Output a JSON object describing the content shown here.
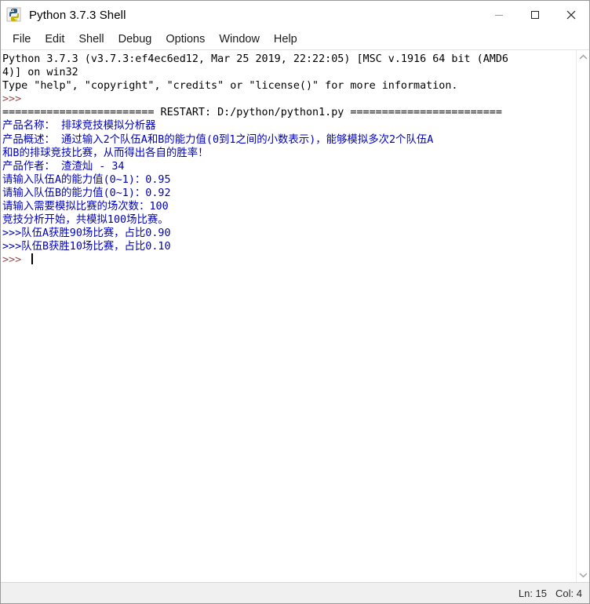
{
  "window": {
    "title": "Python 3.7.3 Shell",
    "icon": "python-idle-icon",
    "controls": {
      "minimize": "minimize-icon",
      "maximize": "maximize-icon",
      "close": "close-icon"
    }
  },
  "menubar": {
    "items": [
      {
        "label": "File"
      },
      {
        "label": "Edit"
      },
      {
        "label": "Shell"
      },
      {
        "label": "Debug"
      },
      {
        "label": "Options"
      },
      {
        "label": "Window"
      },
      {
        "label": "Help"
      }
    ]
  },
  "console": {
    "lines": [
      {
        "segments": [
          {
            "text": "Python 3.7.3 (v3.7.3:ef4ec6ed12, Mar 25 2019, 22:22:05) [MSC v.1916 64 bit (AMD6",
            "color": "black"
          }
        ]
      },
      {
        "segments": [
          {
            "text": "4)] on win32",
            "color": "black"
          }
        ]
      },
      {
        "segments": [
          {
            "text": "Type \"help\", \"copyright\", \"credits\" or \"license()\" for more information.",
            "color": "black"
          }
        ]
      },
      {
        "segments": [
          {
            "text": ">>> ",
            "color": "prompt"
          }
        ]
      },
      {
        "segments": [
          {
            "text": "",
            "color": "black"
          }
        ]
      },
      {
        "segments": [
          {
            "text": "======================== RESTART: D:/python/python1.py ========================",
            "color": "black"
          }
        ]
      },
      {
        "segments": [
          {
            "text": "产品名称： 排球竞技模拟分析器",
            "color": "blue"
          }
        ]
      },
      {
        "segments": [
          {
            "text": "产品概述： 通过输入2个队伍A和B的能力值(0到1之间的小数表示)，能够模拟多次2个队伍A",
            "color": "blue"
          }
        ]
      },
      {
        "segments": [
          {
            "text": "和B的排球竞技比赛，从而得出各自的胜率！",
            "color": "blue"
          }
        ]
      },
      {
        "segments": [
          {
            "text": "产品作者： 渣渣灿 - 34",
            "color": "blue"
          }
        ]
      },
      {
        "segments": [
          {
            "text": "",
            "color": "black"
          }
        ]
      },
      {
        "segments": [
          {
            "text": "请输入队伍A的能力值(0~1)：0.95",
            "color": "blue"
          }
        ]
      },
      {
        "segments": [
          {
            "text": "请输入队伍B的能力值(0~1)：0.92",
            "color": "blue"
          }
        ]
      },
      {
        "segments": [
          {
            "text": "请输入需要模拟比赛的场次数：100",
            "color": "blue"
          }
        ]
      },
      {
        "segments": [
          {
            "text": "竞技分析开始，共模拟100场比赛。",
            "color": "blue"
          }
        ]
      },
      {
        "segments": [
          {
            "text": ">>>队伍A获胜90场比赛，占比0.90",
            "color": "blue"
          }
        ]
      },
      {
        "segments": [
          {
            "text": ">>>队伍B获胜10场比赛，占比0.10",
            "color": "blue"
          }
        ]
      },
      {
        "segments": [
          {
            "text": ">>> ",
            "color": "prompt",
            "cursor": true
          }
        ]
      }
    ]
  },
  "scrollbar": {
    "up_arrow": "chevron-up-icon",
    "down_arrow": "chevron-down-icon"
  },
  "statusbar": {
    "line_label": "Ln: 15",
    "col_label": "Col: 4"
  }
}
